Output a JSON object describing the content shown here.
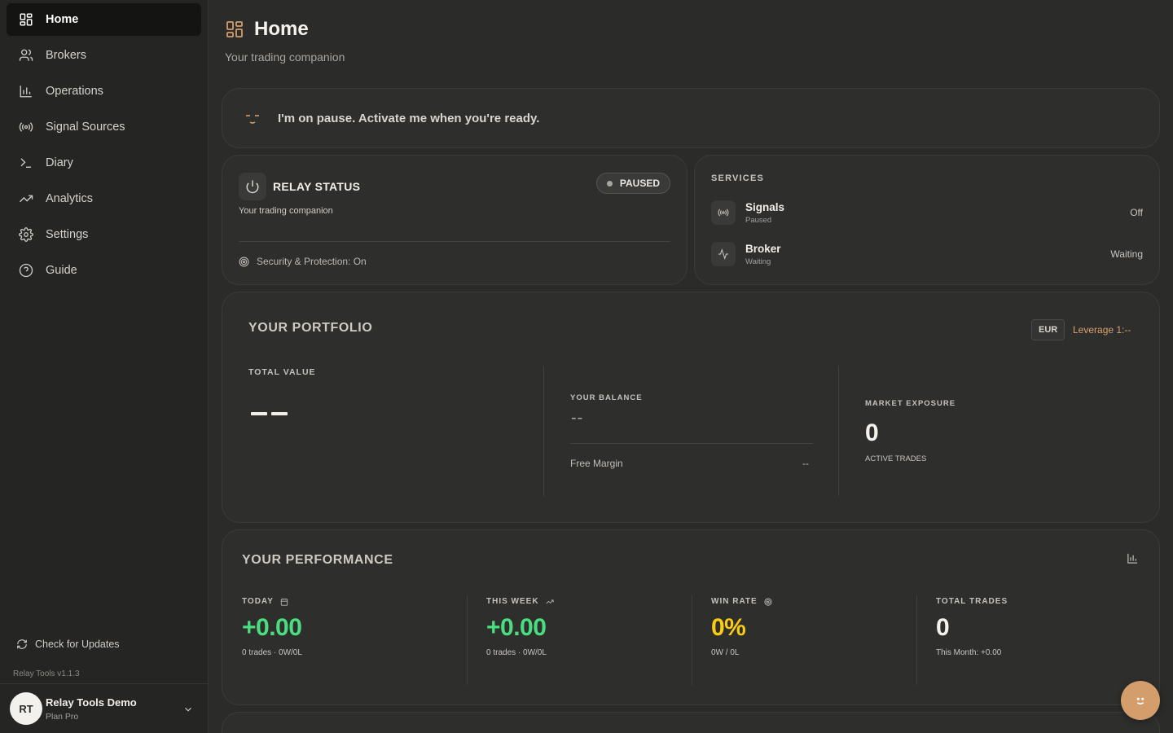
{
  "sidebar": {
    "items": [
      {
        "label": "Home",
        "icon": "grid-icon"
      },
      {
        "label": "Brokers",
        "icon": "users-icon"
      },
      {
        "label": "Operations",
        "icon": "bar-chart-icon"
      },
      {
        "label": "Signal Sources",
        "icon": "radio-icon"
      },
      {
        "label": "Diary",
        "icon": "terminal-icon"
      },
      {
        "label": "Analytics",
        "icon": "trending-up-icon"
      },
      {
        "label": "Settings",
        "icon": "gear-icon"
      },
      {
        "label": "Guide",
        "icon": "help-circle-icon"
      }
    ],
    "active": "Home",
    "check_updates": "Check for Updates",
    "version": "Relay Tools v1.1.3",
    "user": {
      "initials": "RT",
      "name": "Relay Tools Demo",
      "plan": "Plan Pro"
    }
  },
  "header": {
    "title": "Home",
    "subtitle": "Your trading companion"
  },
  "banner": {
    "text": "I'm on pause. Activate me when you're ready."
  },
  "relay": {
    "title": "RELAY STATUS",
    "subtitle": "Your trading companion",
    "badge": "PAUSED",
    "security": "Security & Protection: On"
  },
  "services": {
    "title": "SERVICES",
    "items": [
      {
        "name": "Signals",
        "sub": "Paused",
        "status": "Off",
        "icon": "radio-icon"
      },
      {
        "name": "Broker",
        "sub": "Waiting",
        "status": "Waiting",
        "icon": "activity-icon"
      }
    ]
  },
  "portfolio": {
    "title": "YOUR PORTFOLIO",
    "currency": "EUR",
    "leverage": "Leverage 1:--",
    "total_value_label": "TOTAL VALUE",
    "balance_label": "YOUR BALANCE",
    "balance_value": "--",
    "free_margin_label": "Free Margin",
    "free_margin_value": "--",
    "exposure_label": "MARKET EXPOSURE",
    "exposure_value": "0",
    "exposure_sub": "ACTIVE TRADES"
  },
  "performance": {
    "title": "YOUR PERFORMANCE",
    "stats": [
      {
        "label": "TODAY",
        "value": "+0.00",
        "sub": "0 trades · 0W/0L",
        "icon": "calendar-icon",
        "color": "#4ade80"
      },
      {
        "label": "THIS WEEK",
        "value": "+0.00",
        "sub": "0 trades · 0W/0L",
        "icon": "trending-up-icon",
        "color": "#4ade80"
      },
      {
        "label": "WIN RATE",
        "value": "0%",
        "sub": "0W / 0L",
        "icon": "target-icon",
        "color": "#facc15"
      },
      {
        "label": "TOTAL TRADES",
        "value": "0",
        "sub": "This Month: +0.00",
        "icon": "",
        "color": "#f5f2ed"
      }
    ]
  },
  "colors": {
    "accent": "#d39d6c",
    "positive": "#4ade80",
    "warning": "#facc15",
    "background": "#2b2b2a",
    "sidebar": "#252524"
  }
}
